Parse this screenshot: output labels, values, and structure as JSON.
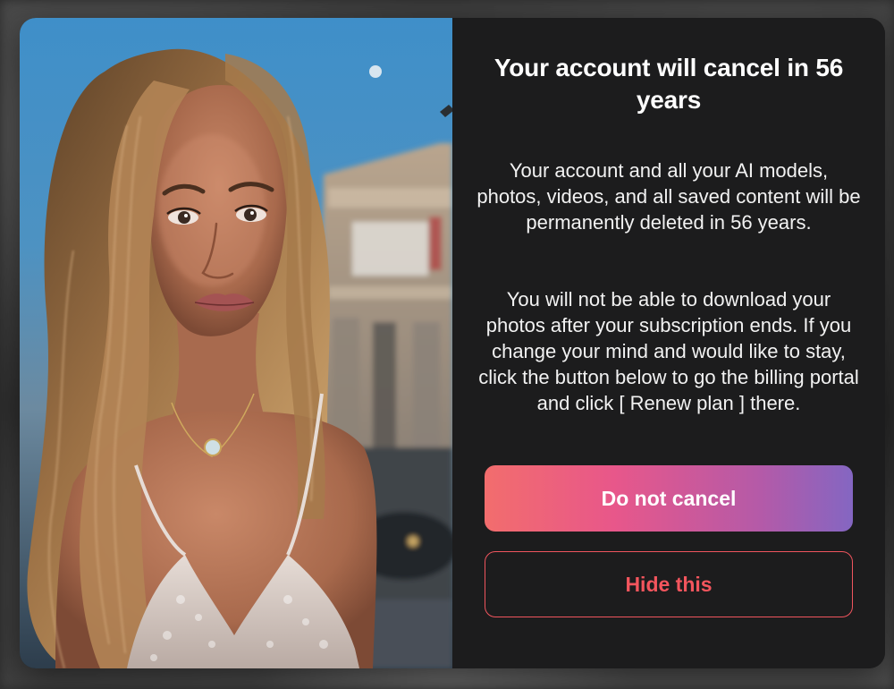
{
  "modal": {
    "title": "Your account will cancel in 56 years",
    "paragraph_1": "Your account and all your AI models, photos, videos, and all saved content will be permanently deleted in 56 years.",
    "paragraph_2": "You will not be able to download your photos after your subscription ends. If you change your mind and would like to stay, click the button below to go the billing portal and click [ Renew plan ] there.",
    "primary_button_label": "Do not cancel",
    "secondary_button_label": "Hide this",
    "image_alt": "Portrait photo of a woman with long wavy blonde hair at dusk"
  },
  "colors": {
    "panel_background": "#1c1c1d",
    "text": "#ffffff",
    "primary_gradient_start": "#f26d6d",
    "primary_gradient_mid": "#e8578a",
    "primary_gradient_end": "#8466c2",
    "secondary_accent": "#f0555e"
  }
}
